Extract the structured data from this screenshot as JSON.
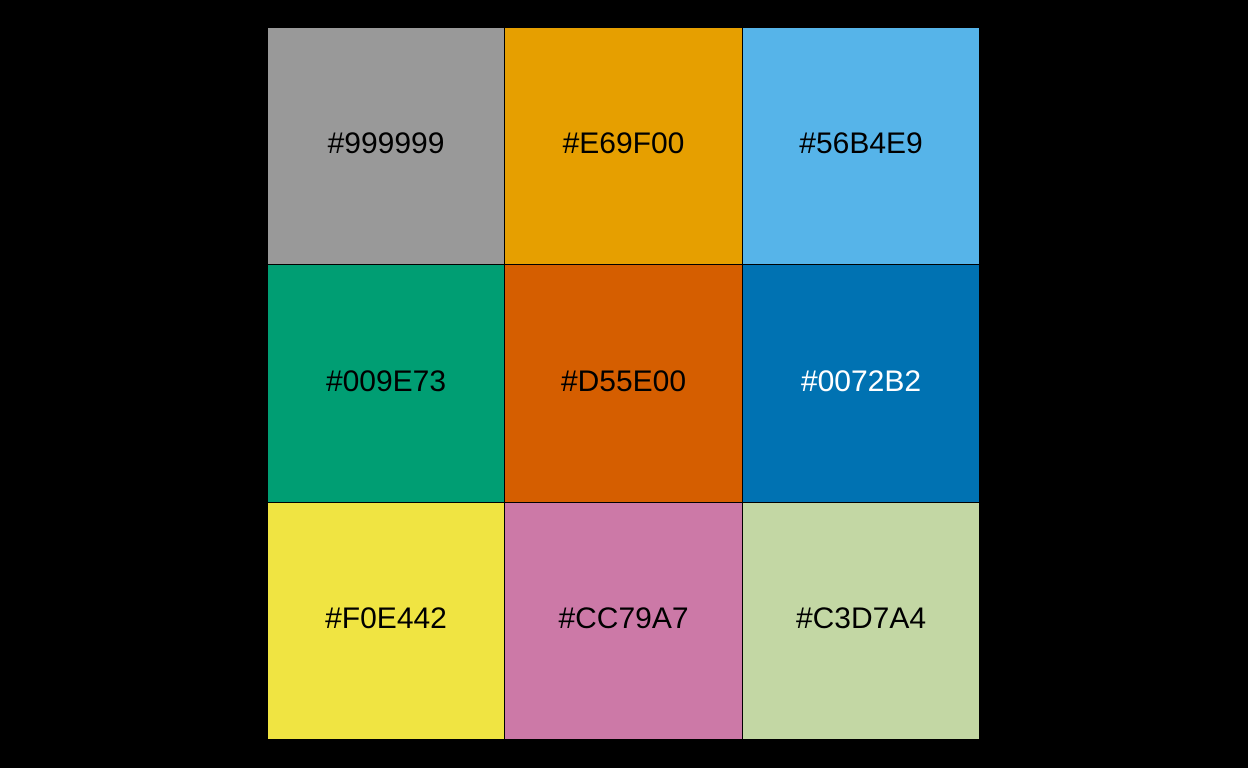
{
  "swatches": [
    {
      "label": "#999999",
      "color": "#999999",
      "text_color": "#000000"
    },
    {
      "label": "#E69F00",
      "color": "#E69F00",
      "text_color": "#000000"
    },
    {
      "label": "#56B4E9",
      "color": "#56B4E9",
      "text_color": "#000000"
    },
    {
      "label": "#009E73",
      "color": "#009E73",
      "text_color": "#000000"
    },
    {
      "label": "#D55E00",
      "color": "#D55E00",
      "text_color": "#000000"
    },
    {
      "label": "#0072B2",
      "color": "#0072B2",
      "text_color": "#FFFFFF"
    },
    {
      "label": "#F0E442",
      "color": "#F0E442",
      "text_color": "#000000"
    },
    {
      "label": "#CC79A7",
      "color": "#CC79A7",
      "text_color": "#000000"
    },
    {
      "label": "#C3D7A4",
      "color": "#C3D7A4",
      "text_color": "#000000"
    }
  ],
  "background_color": "#000000"
}
